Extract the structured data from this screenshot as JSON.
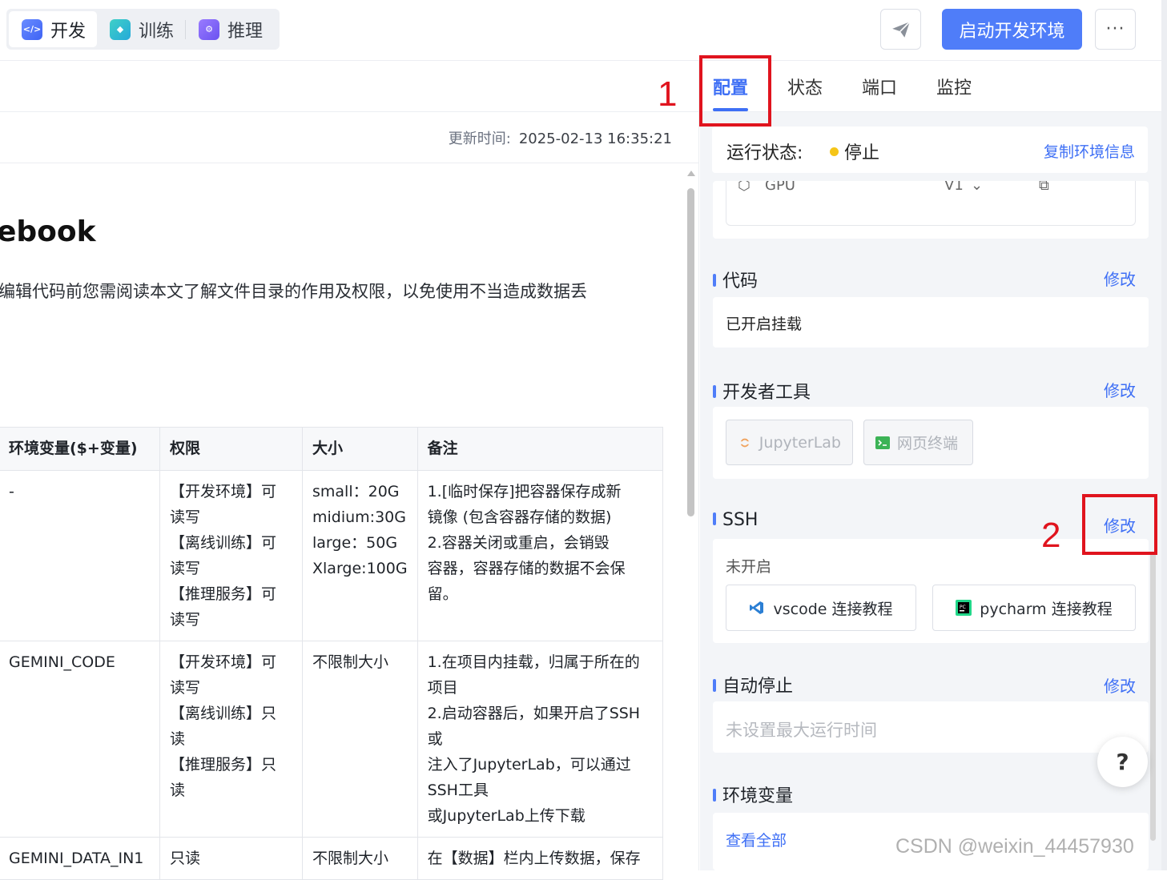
{
  "topbar": {
    "tabs": [
      {
        "label": "开发",
        "icon": "code-icon"
      },
      {
        "label": "训练",
        "icon": "train-icon"
      },
      {
        "label": "推理",
        "icon": "inference-icon"
      }
    ],
    "start_label": "启动开发环境",
    "more_label": "···"
  },
  "doc": {
    "update_label": "更新时间:",
    "update_time": "2025-02-13 16:35:21",
    "title": "ebook",
    "paragraph": "编辑代码前您需阅读本文了解文件目录的作用及权限，以免使用不当造成数据丢",
    "table": {
      "headers": [
        "环境变量($+变量)",
        "权限",
        "大小",
        "备注"
      ],
      "rows": [
        {
          "var": "-",
          "perm": [
            "【开发环境】可",
            "读写",
            "【离线训练】可",
            "读写",
            "【推理服务】可",
            "读写"
          ],
          "size": [
            "small：20G",
            "midium:30G",
            "large：50G",
            "Xlarge:100G"
          ],
          "note": [
            "1.[临时保存]把容器保存成新",
            "镜像 (包含容器存储的数据)",
            "2.容器关闭或重启，会销毁",
            "容器，容器存储的数据不会保",
            "留。"
          ]
        },
        {
          "var": "GEMINI_CODE",
          "perm": [
            "【开发环境】可",
            "读写",
            "【离线训练】只",
            "读",
            "【推理服务】只",
            "读"
          ],
          "size": [
            "不限制大小"
          ],
          "note": [
            "1.在项目内挂载，归属于所在的",
            "项目",
            "2.启动容器后，如果开启了SSH",
            "或",
            "注入了JupyterLab，可以通过",
            "SSH工具",
            "或JupyterLab上传下载"
          ]
        },
        {
          "var": "GEMINI_DATA_IN1",
          "perm": [
            "只读"
          ],
          "size": [
            "不限制大小"
          ],
          "note": [
            "在【数据】栏内上传数据，保存"
          ]
        }
      ]
    }
  },
  "panel": {
    "tabs": [
      "配置",
      "状态",
      "端口",
      "监控"
    ],
    "status_label": "运行状态:",
    "status_value": "停止",
    "status_color": "#f5c518",
    "copy_label": "复制环境信息",
    "resource_partial": [
      "GPU",
      "V1",
      "⌄"
    ],
    "code": {
      "title": "代码",
      "edit": "修改",
      "text": "已开启挂载"
    },
    "devtools": {
      "title": "开发者工具",
      "edit": "修改",
      "jupyter": "JupyterLab",
      "terminal": "网页终端"
    },
    "ssh": {
      "title": "SSH",
      "edit": "修改",
      "text": "未开启",
      "vscode": "vscode 连接教程",
      "pycharm": "pycharm 连接教程"
    },
    "autostop": {
      "title": "自动停止",
      "edit": "修改",
      "text": "未设置最大运行时间"
    },
    "env": {
      "title": "环境变量",
      "link": "查看全部"
    }
  },
  "help_label": "?",
  "annotations": [
    "1",
    "2"
  ],
  "watermark": "CSDN @weixin_44457930",
  "accent_color": "#3e6ff5"
}
